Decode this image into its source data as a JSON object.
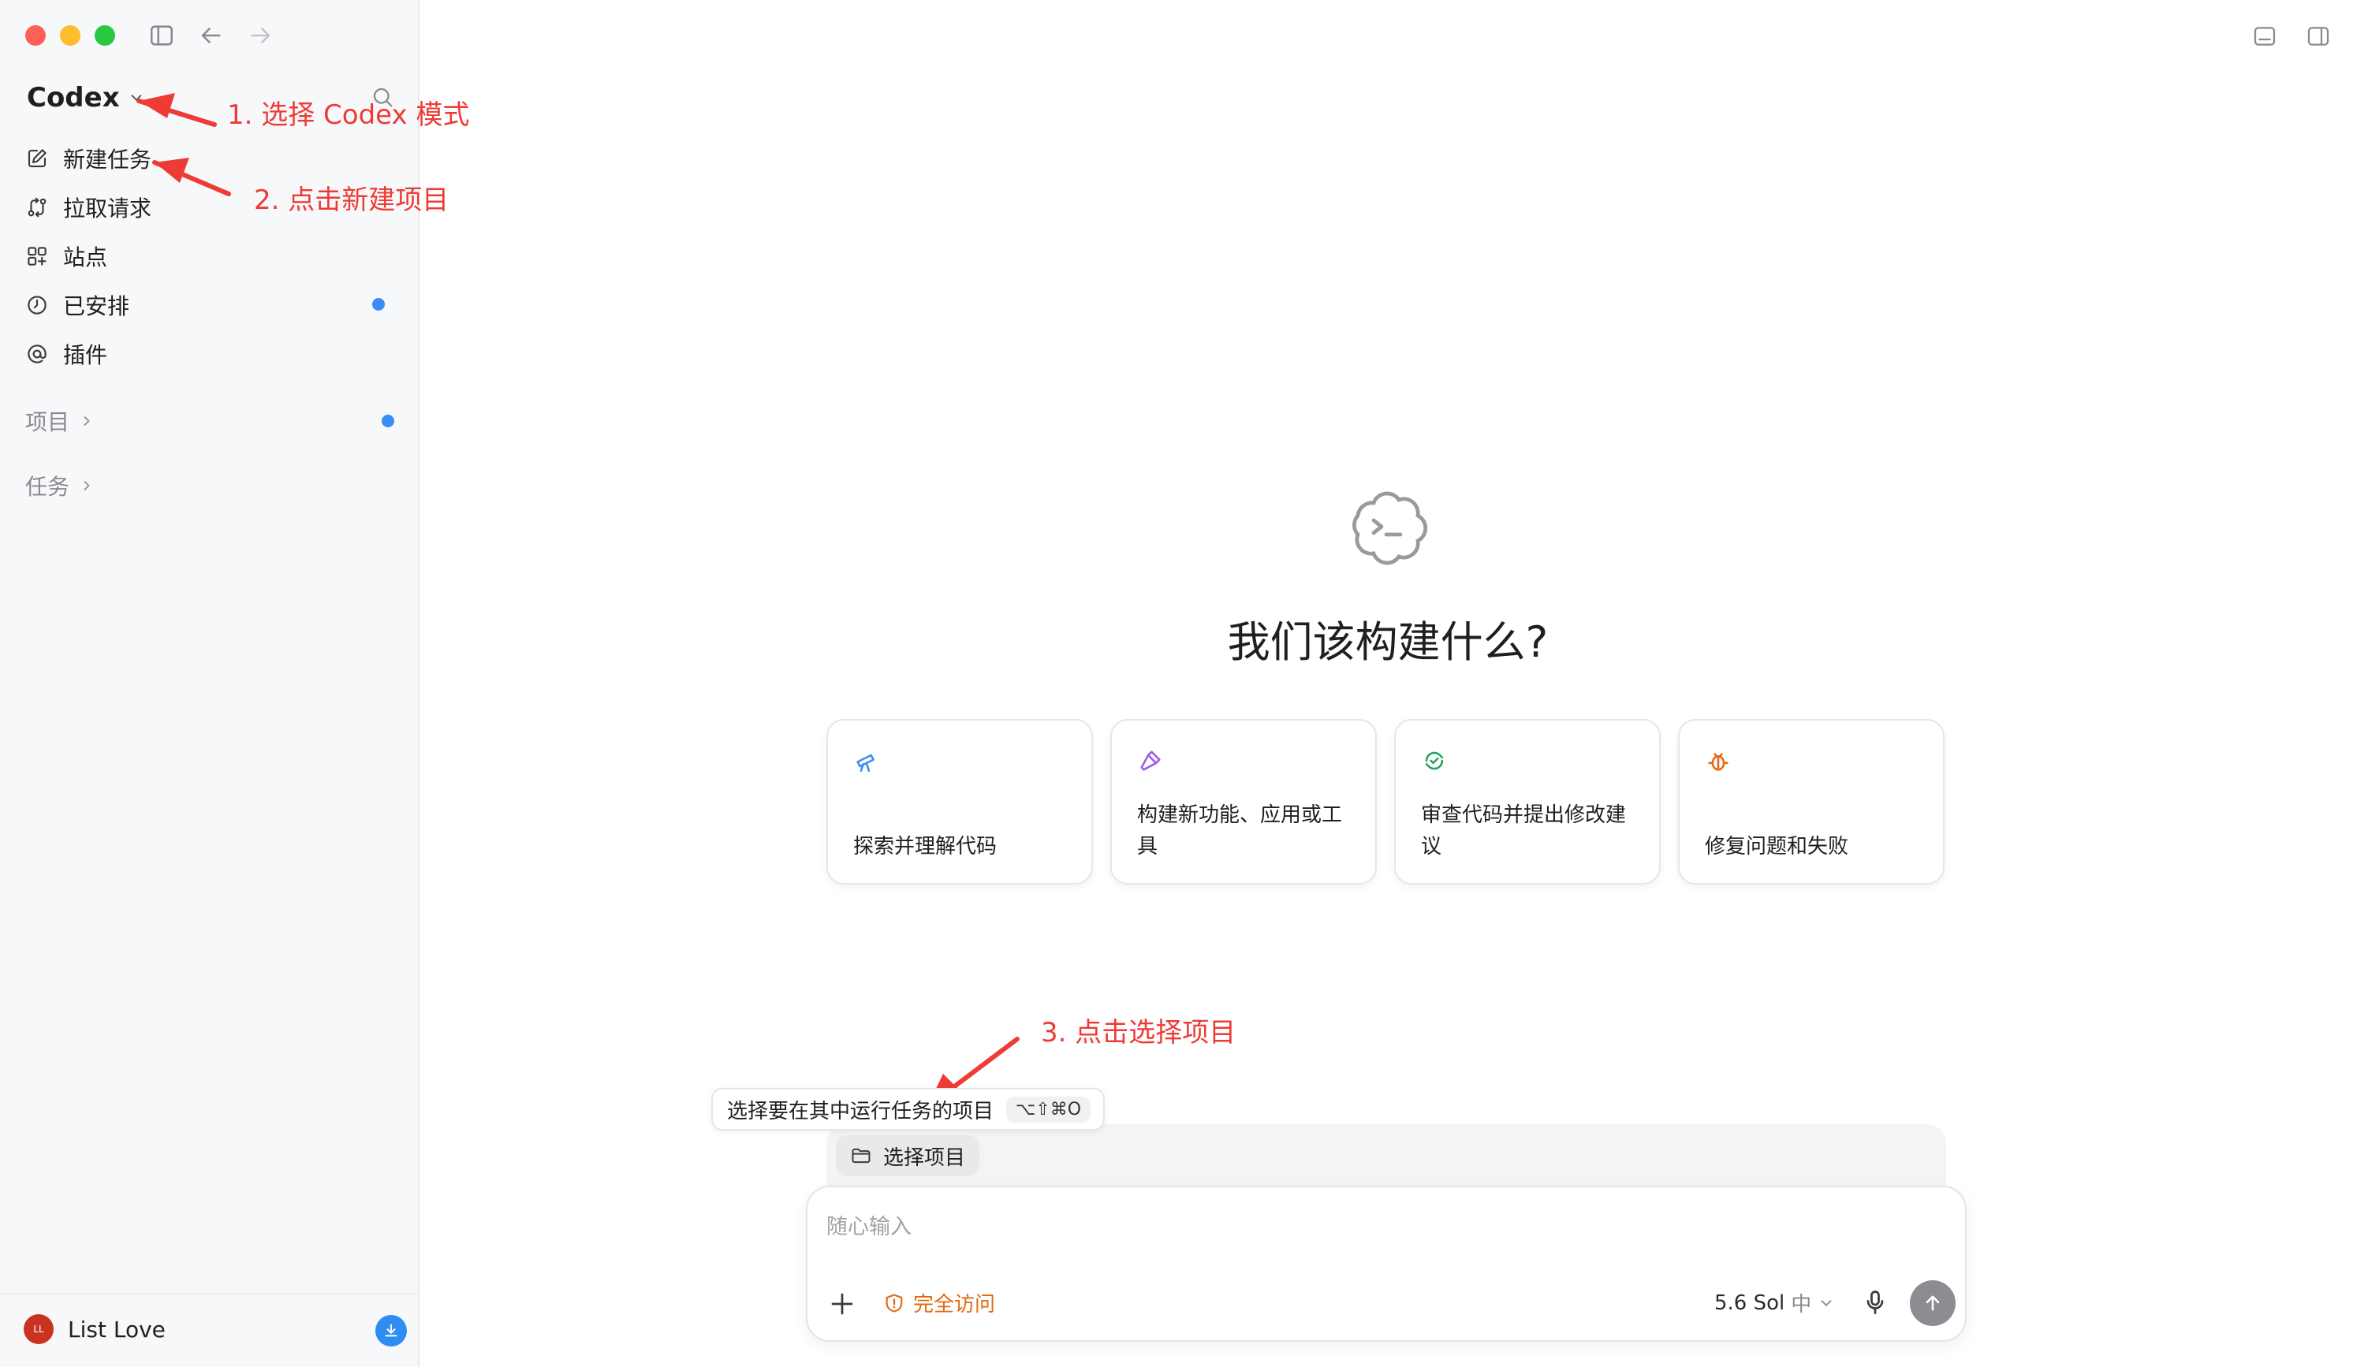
{
  "sidebar": {
    "brand": "Codex",
    "items": [
      {
        "label": "新建任务",
        "icon": "edit-icon"
      },
      {
        "label": "拉取请求",
        "icon": "pull-request-icon"
      },
      {
        "label": "站点",
        "icon": "grid-icon"
      },
      {
        "label": "已安排",
        "icon": "clock-icon"
      },
      {
        "label": "插件",
        "icon": "at-icon"
      }
    ],
    "sections": [
      {
        "label": "项目"
      },
      {
        "label": "任务"
      }
    ],
    "user": {
      "name": "List Love",
      "initials": "LL"
    }
  },
  "annotations": {
    "step1": "1. 选择 Codex 模式",
    "step2": "2. 点击新建项目",
    "step3": "3. 点击选择项目"
  },
  "main": {
    "headline": "我们该构建什么?",
    "cards": [
      {
        "label": "探索并理解代码",
        "icon": "telescope-icon",
        "color": "#3b8cf5"
      },
      {
        "label": "构建新功能、应用或工具",
        "icon": "hammer-icon",
        "color": "#9b5de5"
      },
      {
        "label": "审查代码并提出修改建议",
        "icon": "refresh-check-icon",
        "color": "#27a35b"
      },
      {
        "label": "修复问题和失败",
        "icon": "bug-icon",
        "color": "#e3680f"
      }
    ],
    "tooltip": {
      "text": "选择要在其中运行任务的项目",
      "shortcut": "⌥⇧⌘O"
    },
    "project_button": "选择项目",
    "composer": {
      "placeholder": "随心输入",
      "access_label": "完全访问",
      "model_label": "5.6 Sol",
      "model_speed": "中"
    }
  },
  "colors": {
    "accent": "#3b8cf5",
    "annotation": "#ee3b36",
    "warning": "#e3680f"
  }
}
